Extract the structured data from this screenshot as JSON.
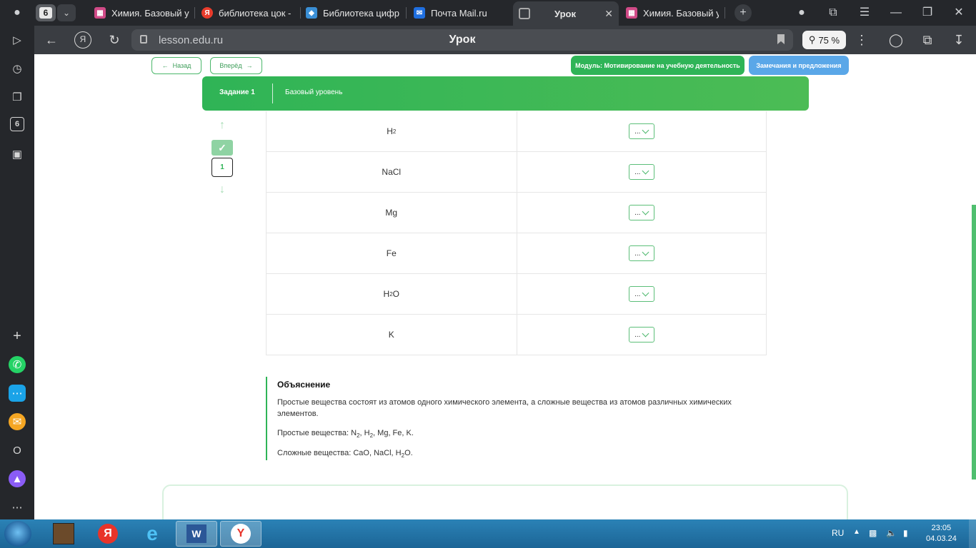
{
  "browser": {
    "tab_count": "6",
    "tabs": [
      {
        "label": "Химия. Базовый у",
        "icon": "lesson-favicon"
      },
      {
        "label": "библиотека цок -",
        "icon": "yandex-favicon"
      },
      {
        "label": "Библиотека цифр",
        "icon": "library-favicon"
      },
      {
        "label": "Почта Mail.ru",
        "icon": "mail-favicon"
      },
      {
        "label": "Урок",
        "icon": "lesson-favicon",
        "active": true
      },
      {
        "label": "Химия. Базовый у",
        "icon": "lesson-favicon"
      }
    ],
    "url": "lesson.edu.ru",
    "page_title": "Урок",
    "zoom": "75 %"
  },
  "lesson": {
    "back_label": "Назад",
    "forward_label": "Вперёд",
    "module_label": "Модуль: Мотивирование на учебную деятельность",
    "remarks_label": "Замечания и предложения",
    "task_label": "Задание 1",
    "level_label": "Базовый уровень",
    "task_number": "1",
    "select_placeholder": "...",
    "rows": [
      {
        "formula_main": "H",
        "formula_sub": "2",
        "formula_tail": ""
      },
      {
        "formula_main": "NaCl",
        "formula_sub": "",
        "formula_tail": ""
      },
      {
        "formula_main": "Mg",
        "formula_sub": "",
        "formula_tail": ""
      },
      {
        "formula_main": "Fe",
        "formula_sub": "",
        "formula_tail": ""
      },
      {
        "formula_main": "H",
        "formula_sub": "2",
        "formula_tail": "O"
      },
      {
        "formula_main": "K",
        "formula_sub": "",
        "formula_tail": ""
      }
    ],
    "explanation": {
      "title": "Объяснение",
      "text": "Простые вещества состоят из атомов одного химического элемента, а сложные вещества из атомов различных химических элементов.",
      "simple_a": "Простые вещества: N",
      "simple_sub1": "2",
      "simple_b": ", H",
      "simple_sub2": "2",
      "simple_c": ", Mg, Fe, K.",
      "complex_a": "Сложные вещества: CaO, NaCl, H",
      "complex_sub": "2",
      "complex_b": "O."
    }
  },
  "taskbar": {
    "lang": "RU",
    "time": "23:05",
    "date": "04.03.24"
  }
}
